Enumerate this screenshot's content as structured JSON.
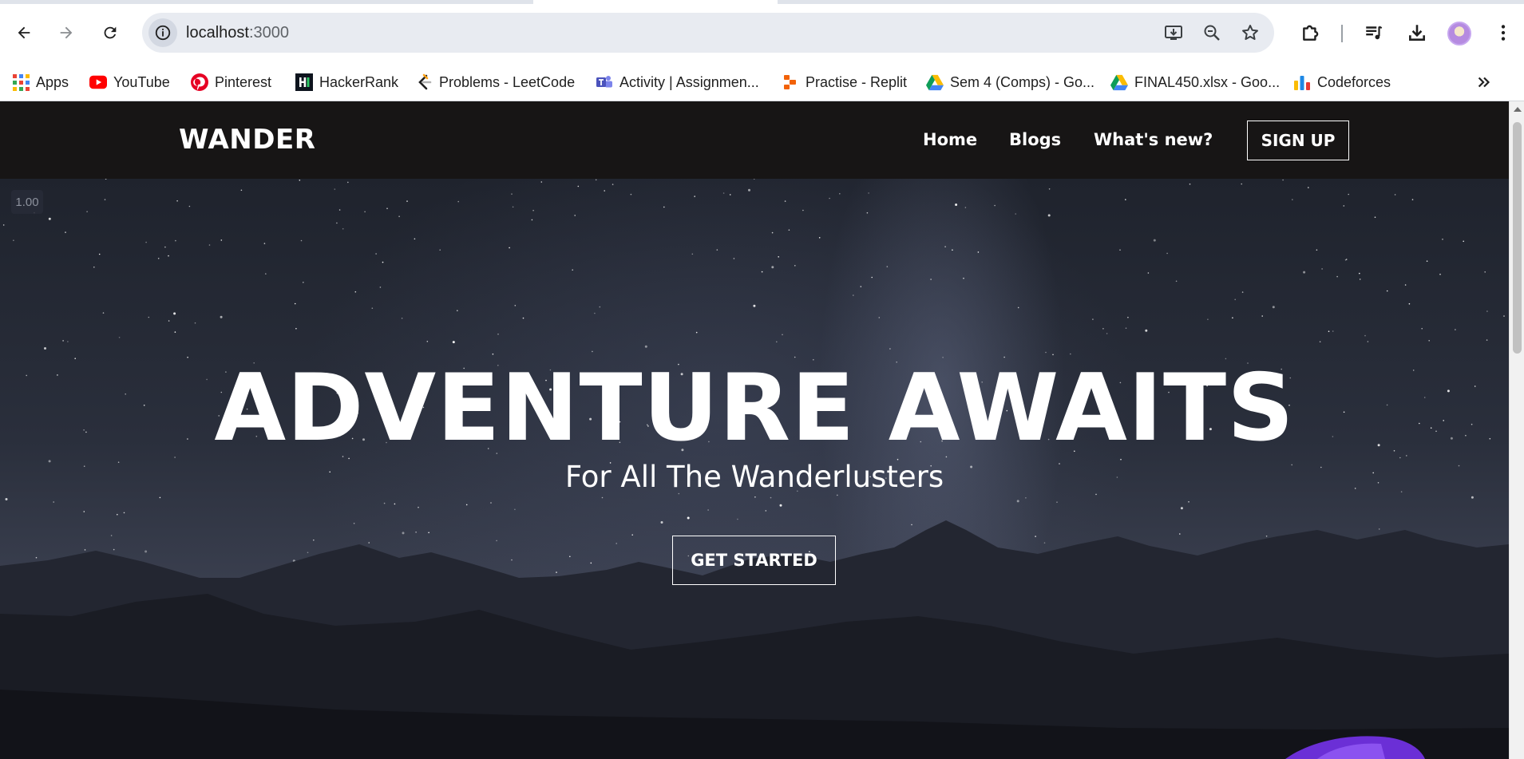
{
  "browser": {
    "url_host": "localhost",
    "url_port": ":3000",
    "bookmarks": [
      {
        "label": "Apps",
        "icon": "apps-grid-icon"
      },
      {
        "label": "YouTube",
        "icon": "youtube-icon"
      },
      {
        "label": "Pinterest",
        "icon": "pinterest-icon"
      },
      {
        "label": "HackerRank",
        "icon": "hackerrank-icon"
      },
      {
        "label": "Problems - LeetCode",
        "icon": "leetcode-icon"
      },
      {
        "label": "Activity | Assignmen...",
        "icon": "teams-icon"
      },
      {
        "label": "Practise - Replit",
        "icon": "replit-icon"
      },
      {
        "label": "Sem 4 (Comps) - Go...",
        "icon": "google-drive-icon"
      },
      {
        "label": "FINAL450.xlsx - Goo...",
        "icon": "google-drive-icon"
      },
      {
        "label": "Codeforces",
        "icon": "codeforces-icon"
      }
    ]
  },
  "site": {
    "brand": "WANDER",
    "nav": [
      "Home",
      "Blogs",
      "What's new?"
    ],
    "signup_label": "SIGN UP",
    "hero": {
      "fps_badge": "1.00",
      "title": "ADVENTURE AWAITS",
      "subtitle": "For All The Wanderlusters",
      "cta_label": "GET STARTED"
    }
  },
  "colors": {
    "nav_bg": "#171515",
    "hero_sky": "#2a2f3c",
    "mountains": "#1a1c24"
  }
}
